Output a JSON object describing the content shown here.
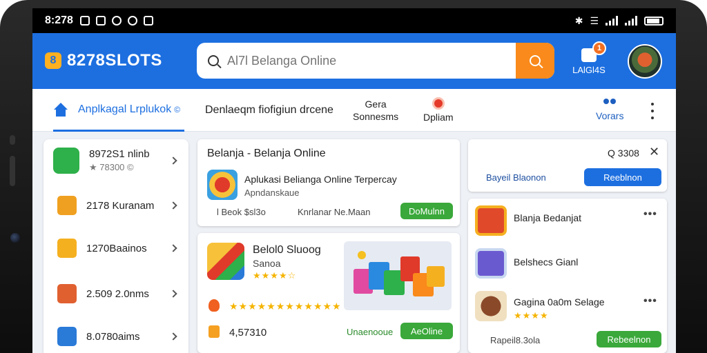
{
  "status_bar": {
    "time": "8:278"
  },
  "header": {
    "brand": "8278SLOTS",
    "logo_mark": "8",
    "search_placeholder": "Al7l Belanga Online",
    "lang_label": "LAlGl4S",
    "notification_count": "1"
  },
  "tabs": {
    "home_label": "Anplkagal Lrplukok",
    "home_suffix": "©",
    "tab2": "Denlaeqm fiofigiun drcene",
    "tab3_line1": "Gera",
    "tab3_line2": "Sonnesms",
    "tab4": "Dpliam",
    "tab5": "Vorars"
  },
  "left_list": [
    {
      "title": "8972S1 nlinb",
      "subtitle": "★ 78300 ©",
      "icon": "wallet-icon",
      "color": "#2eb04a"
    },
    {
      "title": "2178 Kuranam",
      "icon": "box-icon",
      "color": "#f0a020"
    },
    {
      "title": "1270Baainos",
      "icon": "lock-icon",
      "color": "#f5b020"
    },
    {
      "title": "2.509 2.0nms",
      "icon": "gift-icon",
      "color": "#e06030"
    },
    {
      "title": "8.0780aims",
      "icon": "card-icon",
      "color": "#2a7ad8"
    }
  ],
  "card1": {
    "title": "Belanja - Belanja Online",
    "line1": "Aplukasi Belianga Online Terpercay",
    "line2": "Apndanskaue",
    "meta1": "l Beok $sl3o",
    "meta2": "Knrlanar Ne.Maan",
    "button": "DoMulnn"
  },
  "card2": {
    "title": "Belol0 Sluoog",
    "subtitle": "Sanoa",
    "stars": "★★★★☆",
    "stars_long": "★★★★★★★★★★★★",
    "amount": "4,57310",
    "link": "Unaenooue",
    "button": "AeOline"
  },
  "filter_card": {
    "search_text": "Q 3308",
    "left": "Bayeil Blaonon",
    "button": "Reeblnon"
  },
  "right_list": [
    {
      "title": "Blanja Bedanjat",
      "has_more": true
    },
    {
      "title": "Belshecs Gianl",
      "has_more": false
    },
    {
      "title": "Gagina 0a0m Selage",
      "stars": "★★★★",
      "has_more": true
    }
  ],
  "right_footer": {
    "left": "Rapeil8.3ola",
    "button": "Rebeelnon"
  }
}
